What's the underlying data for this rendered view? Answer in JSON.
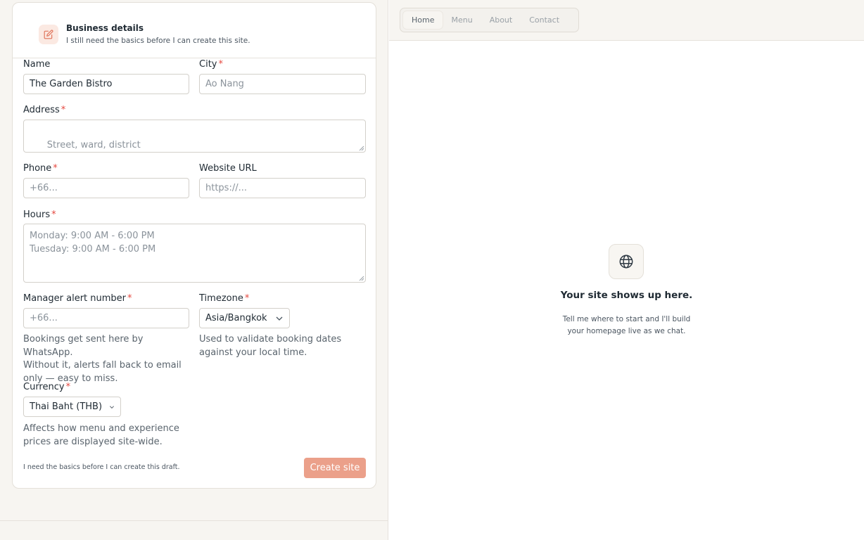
{
  "form": {
    "header": {
      "icon": "pencil-edit-icon",
      "title": "Business details",
      "subtitle": "I still need the basics before I can create this site."
    },
    "name": {
      "label": "Name",
      "value": "The Garden Bistro"
    },
    "city": {
      "label": "City",
      "placeholder": "Ao Nang"
    },
    "address": {
      "label": "Address",
      "placeholder": "Street, ward, district"
    },
    "phone": {
      "label": "Phone",
      "placeholder": "+66..."
    },
    "website": {
      "label": "Website URL",
      "placeholder": "https://..."
    },
    "hours": {
      "label": "Hours",
      "placeholder_line1": "Monday: 9:00 AM - 6:00 PM",
      "placeholder_line2": "Tuesday: 9:00 AM - 6:00 PM"
    },
    "manager_alert": {
      "label": "Manager alert number",
      "placeholder": "+66...",
      "help_line1": "Bookings get sent here by WhatsApp.",
      "help_line2": "Without it, alerts fall back to email",
      "help_line3": "only — easy to miss."
    },
    "timezone": {
      "label": "Timezone",
      "value": "Asia/Bangkok",
      "help_line1": "Used to validate booking dates",
      "help_line2": "against your local time."
    },
    "currency": {
      "label": "Currency",
      "value": "Thai Baht (THB)",
      "help_line1": "Affects how menu and experience",
      "help_line2": "prices are displayed site-wide."
    },
    "required_marker": "*",
    "footer_note": "I need the basics before I can create this draft.",
    "create_button": "Create site"
  },
  "preview": {
    "nav": [
      "Home",
      "Menu",
      "About",
      "Contact"
    ],
    "active_nav": "Home",
    "empty_icon": "globe-icon",
    "empty_title": "Your site shows up here.",
    "empty_text_line1": "Tell me where to start and I'll build",
    "empty_text_line2": "your homepage live as we chat."
  },
  "colors": {
    "accent": "#eba08a",
    "required": "#e5483f",
    "panel_bg": "#f7f5f1"
  }
}
